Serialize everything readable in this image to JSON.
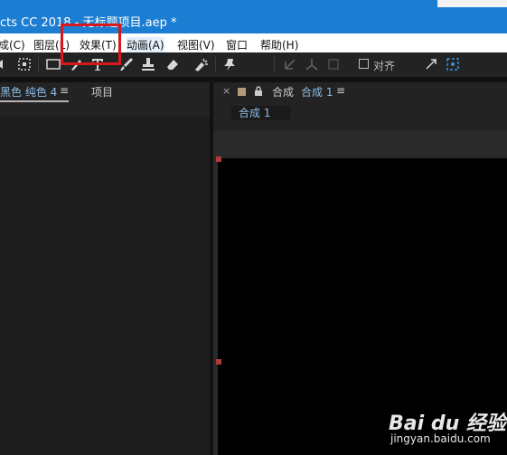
{
  "titlebar": {
    "title": "cts CC 2018 - 无标题项目.aep *"
  },
  "menubar": {
    "items": [
      "成(C)",
      "图层(L)",
      "效果(T)",
      "动画(A)",
      "视图(V)",
      "窗口",
      "帮助(H)"
    ]
  },
  "toolbar": {
    "snap_label": "对齐"
  },
  "left_panel": {
    "active_tab": "黑色 纯色 4",
    "menu_glyph": "≡",
    "project_tab": "项目"
  },
  "right_panel": {
    "close": "×",
    "comp_label": "合成",
    "comp_name": "合成 1",
    "menu_glyph": "≡",
    "comp_tab": "合成 1"
  },
  "watermark": {
    "logo": "Bai du 经验",
    "site": "jingyan.baidu.com"
  },
  "colors": {
    "titlebar": "#1c7ed3",
    "highlight": "#d7191f",
    "accent_text": "#8ebde8"
  }
}
